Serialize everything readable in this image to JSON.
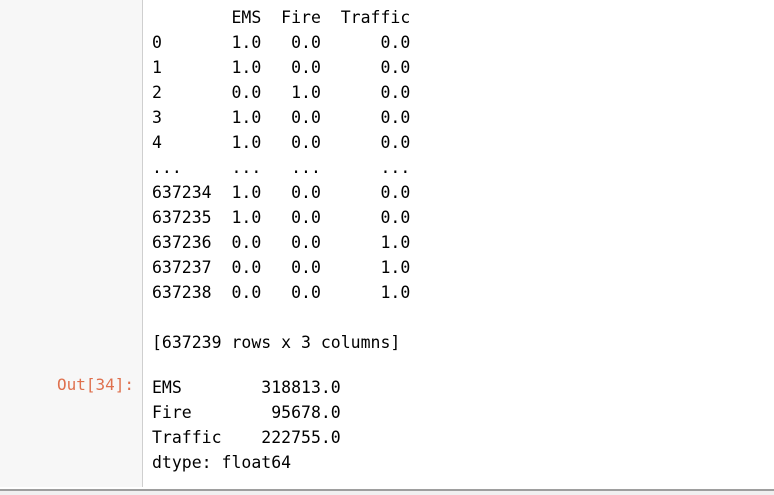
{
  "output_prompt": "Out[34]:",
  "dataframe": {
    "header": "        EMS  Fire  Traffic",
    "rows": [
      "0       1.0   0.0      0.0",
      "1       1.0   0.0      0.0",
      "2       0.0   1.0      0.0",
      "3       1.0   0.0      0.0",
      "4       1.0   0.0      0.0",
      "...     ...   ...      ...",
      "637234  1.0   0.0      0.0",
      "637235  1.0   0.0      0.0",
      "637236  0.0   0.0      1.0",
      "637237  0.0   0.0      1.0",
      "637238  0.0   0.0      1.0"
    ],
    "shape_note": "[637239 rows x 3 columns]"
  },
  "series": {
    "rows": [
      "EMS        318813.0",
      "Fire        95678.0",
      "Traffic    222755.0"
    ],
    "dtype": "dtype: float64"
  }
}
